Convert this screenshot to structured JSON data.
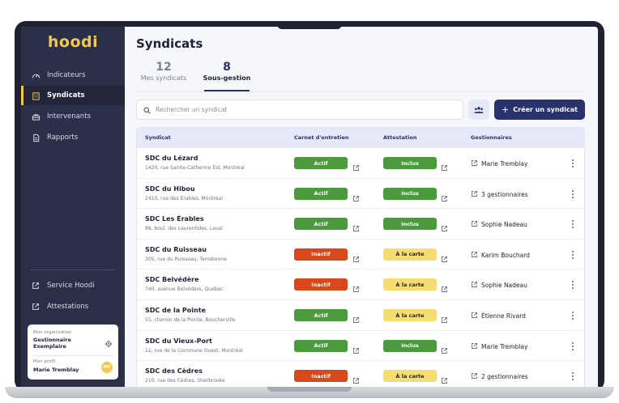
{
  "app": {
    "logo": "hoodi"
  },
  "sidebar": {
    "items": [
      {
        "label": "Indicateurs",
        "icon": "gauge-icon"
      },
      {
        "label": "Syndicats",
        "icon": "building-icon"
      },
      {
        "label": "Intervenants",
        "icon": "toolbox-icon"
      },
      {
        "label": "Rapports",
        "icon": "document-icon"
      }
    ],
    "bottom_items": [
      {
        "label": "Service Hoodi",
        "icon": "external-link-icon"
      },
      {
        "label": "Attestations",
        "icon": "external-link-icon"
      }
    ],
    "org": {
      "org_label": "Mon organisation",
      "org_name": "Gestionnaire Exemplaire",
      "profile_label": "Mon profil",
      "profile_name": "Marie Tremblay",
      "avatar_initials": "MT"
    }
  },
  "main": {
    "title": "Syndicats",
    "tabs": [
      {
        "count": "12",
        "label": "Mes syndicats",
        "active": false
      },
      {
        "count": "8",
        "label": "Sous-gestion",
        "active": true
      }
    ],
    "search_placeholder": "Rechercher un syndicat",
    "create_label": "Créer un syndicat"
  },
  "table": {
    "headers": [
      "Syndicat",
      "Carnet d'entretien",
      "Attestation",
      "Gestionnaires"
    ],
    "rows": [
      {
        "name": "SDC du Lézard",
        "address": "1420, rue Sainte-Catherine Est, Montréal",
        "carnet": "Actif",
        "attestation": "Inclus",
        "gestionnaire": "Marie Tremblay"
      },
      {
        "name": "SDC du Hibou",
        "address": "2410, rue des Érables, Montréal",
        "carnet": "Actif",
        "attestation": "Inclus",
        "gestionnaire": "3 gestionnaires"
      },
      {
        "name": "SDC Les Érables",
        "address": "88, boul. des Laurentides, Laval",
        "carnet": "Actif",
        "attestation": "Inclus",
        "gestionnaire": "Sophie Nadeau"
      },
      {
        "name": "SDC du Ruisseau",
        "address": "305, rue du Ruisseau, Terrebonne",
        "carnet": "Inactif",
        "attestation": "À la carte",
        "gestionnaire": "Karim Bouchard"
      },
      {
        "name": "SDC Belvédère",
        "address": "740, avenue Belvédère, Québec",
        "carnet": "Inactif",
        "attestation": "À la carte",
        "gestionnaire": "Sophie Nadeau"
      },
      {
        "name": "SDC de la Pointe",
        "address": "55, chemin de la Pointe, Boucherville",
        "carnet": "Actif",
        "attestation": "À la carte",
        "gestionnaire": "Étienne Rivard"
      },
      {
        "name": "SDC du Vieux-Port",
        "address": "12, rue de la Commune Ouest, Montréal",
        "carnet": "Actif",
        "attestation": "Inclus",
        "gestionnaire": "Marie Tremblay"
      },
      {
        "name": "SDC des Cèdres",
        "address": "210, rue des Cèdres, Sherbrooke",
        "carnet": "Inactif",
        "attestation": "À la carte",
        "gestionnaire": "2 gestionnaires"
      }
    ]
  },
  "colors": {
    "sidebar": "#2b2f47",
    "accent_yellow": "#f2c94c",
    "primary": "#28326d",
    "status_active": "#4c9a3e",
    "status_inactive": "#d9481a",
    "status_a_la_carte": "#f6dd72",
    "status_inclus": "#4c9a3e"
  }
}
